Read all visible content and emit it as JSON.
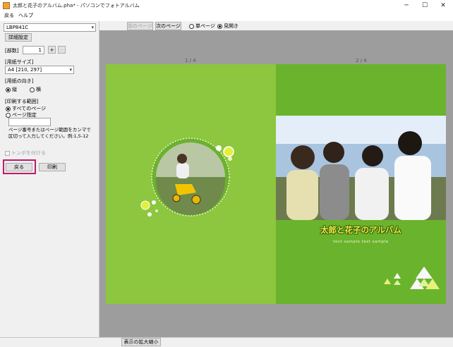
{
  "window": {
    "title": "太郎と花子のアルバム.pha* - パソコンでフォトアルバム",
    "minimize_glyph": "─",
    "maximize_glyph": "☐",
    "close_glyph": "✕"
  },
  "menu": {
    "items": [
      "戻る",
      "ヘルプ"
    ]
  },
  "panel": {
    "printer": "LBP841C",
    "detail_button": "詳細設定",
    "copies_label": "[部数]",
    "copies_value": "1",
    "plus": "+",
    "minus": "-",
    "paper_size_label": "[用紙サイズ]",
    "paper_size_value": "A4 [210, 297]",
    "orientation_label": "[用紙の向き]",
    "orientation_portrait": "縦",
    "orientation_landscape": "横",
    "range_label": "[印刷する範囲]",
    "range_all": "すべてのページ",
    "range_specify": "ページ指定",
    "range_help": "ページ番号またはページ範囲をカンマで区切って入力してください。例:1,5-12",
    "trim_marks": "トンボを付ける",
    "back_button": "戻る",
    "print_button": "印刷"
  },
  "toolbar": {
    "prev_page": "前のページ",
    "next_page": "次のページ",
    "single_page": "単ページ",
    "spread": "見開き"
  },
  "preview": {
    "left_page_label": "1 / 4",
    "right_page_label": "2 / 4",
    "album_title": "太郎と花子のアルバム",
    "album_subtitle": "text sample text sample"
  },
  "status": {
    "zoom_button": "表示の拡大縮小"
  },
  "colors": {
    "page_green": "#8dc63f",
    "page_green_dark": "#6ab42d",
    "highlight": "#c0196b"
  }
}
